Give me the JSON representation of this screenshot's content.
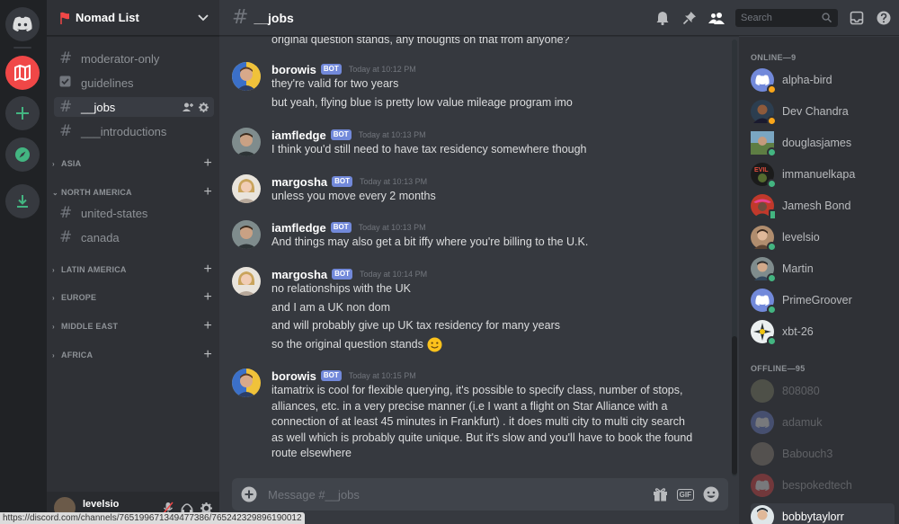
{
  "colors": {
    "blurple": "#7289da",
    "online": "#43b581",
    "idle": "#faa61a",
    "bg_main": "#36393f",
    "bg_sidebar": "#2f3136",
    "bg_rail": "#202225",
    "server_red": "#f04747"
  },
  "rail": {
    "icons": [
      "discord-home-icon",
      "nomad-list-server-icon",
      "add-server-icon",
      "explore-servers-icon",
      "download-apps-icon"
    ]
  },
  "guild": {
    "name": "Nomad List"
  },
  "channels": [
    {
      "name": "moderator-only",
      "icon": "hash"
    },
    {
      "name": "guidelines",
      "icon": "rules-checkbox"
    },
    {
      "name": "__jobs",
      "icon": "hash",
      "active": true
    },
    {
      "name": "___introductions",
      "icon": "hash"
    }
  ],
  "categories": [
    {
      "name": "ASIA",
      "channels": []
    },
    {
      "name": "NORTH AMERICA",
      "channels": [
        "united-states",
        "canada"
      ]
    },
    {
      "name": "LATIN AMERICA",
      "channels": []
    },
    {
      "name": "EUROPE",
      "channels": []
    },
    {
      "name": "MIDDLE EAST",
      "channels": []
    },
    {
      "name": "AFRICA",
      "channels": []
    }
  ],
  "user_panel": {
    "username": "levelsio"
  },
  "status_url": "https://discord.com/channels/765199671349477386/765242329896190012",
  "header": {
    "channel": "__jobs",
    "search_placeholder": "Search"
  },
  "messages": {
    "partial_top": "original question stands, any thoughts on that from anyone?",
    "groups": [
      {
        "author": "borowis",
        "bot": "BOT",
        "time": "Today at 10:12 PM",
        "lines": [
          "they're valid for two years",
          "but yeah, flying blue is pretty low value mileage program imo"
        ]
      },
      {
        "author": "iamfledge",
        "bot": "BOT",
        "time": "Today at 10:13 PM",
        "lines": [
          "I think you'd still need to have tax residency somewhere though"
        ]
      },
      {
        "author": "margosha",
        "bot": "BOT",
        "time": "Today at 10:13 PM",
        "lines": [
          "unless you move every 2 months"
        ]
      },
      {
        "author": "iamfledge",
        "bot": "BOT",
        "time": "Today at 10:13 PM",
        "lines": [
          "And things may also get a bit iffy where you're billing to the U.K."
        ]
      },
      {
        "author": "margosha",
        "bot": "BOT",
        "time": "Today at 10:14 PM",
        "lines": [
          "no relationships with the UK",
          "and I am a UK non dom",
          "and will probably give up UK tax residency for many years",
          "so the original question stands"
        ]
      },
      {
        "author": "borowis",
        "bot": "BOT",
        "time": "Today at 10:15 PM",
        "paragraph": "itamatrix is cool for flexible querying, it's possible to specify class, number of stops, alliances, etc. in a very precise manner (i.e I want a flight on Star Alliance with a connection of at least 45 minutes in Frankfurt) . it does multi city to multi city search as well which is probably quite unique. But it's slow and you'll have to book the found route elsewhere"
      }
    ]
  },
  "composer": {
    "placeholder": "Message #__jobs",
    "gif_label": "GIF"
  },
  "members": {
    "online_label": "ONLINE—9",
    "offline_label": "OFFLINE—95",
    "online": [
      {
        "name": "alpha-bird",
        "status": "idle"
      },
      {
        "name": "Dev Chandra",
        "status": "idle"
      },
      {
        "name": "douglasjames",
        "status": "online"
      },
      {
        "name": "immanuelkapa",
        "status": "online"
      },
      {
        "name": "Jamesh Bond",
        "status": "mobile"
      },
      {
        "name": "levelsio",
        "status": "online"
      },
      {
        "name": "Martin",
        "status": "online"
      },
      {
        "name": "PrimeGroover",
        "status": "online"
      },
      {
        "name": "xbt-26",
        "status": "online"
      }
    ],
    "offline": [
      {
        "name": "808080"
      },
      {
        "name": "adamuk"
      },
      {
        "name": "Babouch3"
      },
      {
        "name": "bespokedtech"
      },
      {
        "name": "bobbytaylorr"
      }
    ]
  }
}
